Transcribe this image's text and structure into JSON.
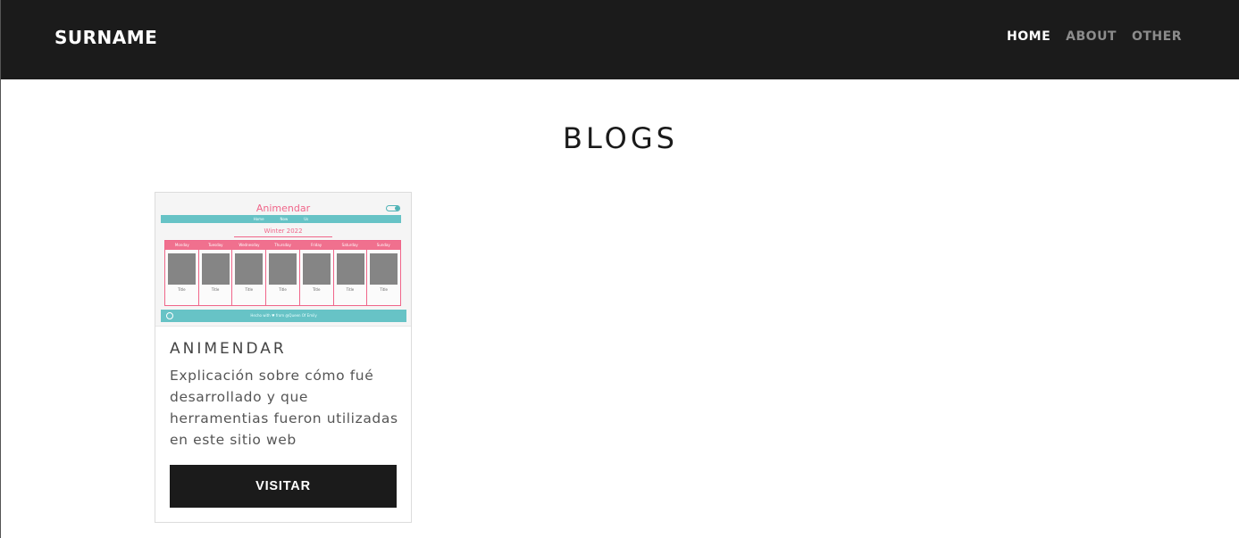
{
  "navbar": {
    "brand": "SURNAME",
    "links": [
      {
        "label": "HOME",
        "active": true
      },
      {
        "label": "ABOUT",
        "active": false
      },
      {
        "label": "OTHER",
        "active": false
      }
    ]
  },
  "page": {
    "title": "BLOGS"
  },
  "cards": [
    {
      "title": "ANIMENDAR",
      "description": "Explicación sobre cómo fué desarrollado y que herramentias fueron utilizadas en este sitio web",
      "button_label": "VISITAR",
      "thumbnail": {
        "title": "Animendar",
        "nav": [
          "Home",
          "Now",
          "Us"
        ],
        "season": "Winter 2022",
        "days": [
          "Monday",
          "Tuesday",
          "Wednesday",
          "Thursday",
          "Friday",
          "Saturday",
          "Sunday"
        ],
        "item_labels": [
          "Title",
          "Title",
          "Title",
          "Title",
          "Title",
          "Title",
          "Title"
        ],
        "footer": "Hecho with ♥ from @Queen Of Emily",
        "colors": {
          "pink": "#f0668a",
          "teal": "#67c3c6"
        }
      }
    }
  ]
}
